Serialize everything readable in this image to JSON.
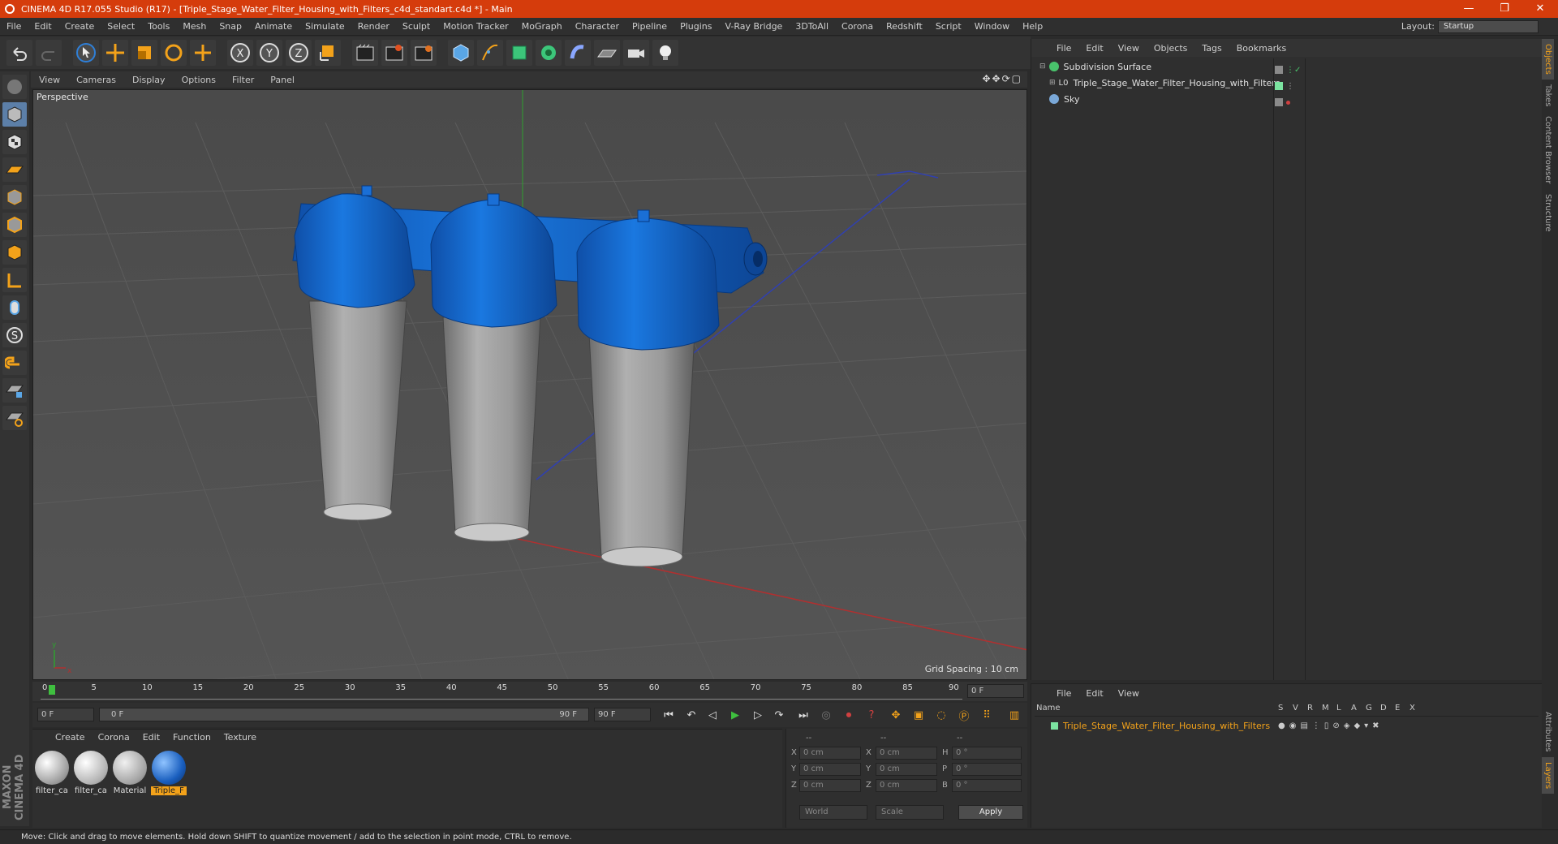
{
  "window": {
    "title": "CINEMA 4D R17.055 Studio (R17) - [Triple_Stage_Water_Filter_Housing_with_Filters_c4d_standart.c4d *] - Main",
    "controls": [
      "—",
      "❐",
      "✕"
    ]
  },
  "menubar": {
    "items": [
      "File",
      "Edit",
      "Create",
      "Select",
      "Tools",
      "Mesh",
      "Snap",
      "Animate",
      "Simulate",
      "Render",
      "Sculpt",
      "Motion Tracker",
      "MoGraph",
      "Character",
      "Pipeline",
      "Plugins",
      "V-Ray Bridge",
      "3DToAll",
      "Corona",
      "Redshift",
      "Script",
      "Window",
      "Help"
    ],
    "layout_label": "Layout:",
    "layout_value": "Startup"
  },
  "toolbar": {
    "icons": [
      "undo-icon",
      "redo-icon",
      "select-icon",
      "move-icon",
      "scale-icon",
      "rotate-icon",
      "recent-tool-icon",
      "x-axis-icon",
      "y-axis-icon",
      "z-axis-icon",
      "coordinate-system-icon",
      "render-view-icon",
      "render-picture-viewer-icon",
      "edit-render-settings-icon",
      "cube-icon",
      "pen-icon",
      "subdivision-icon",
      "array-icon",
      "deformer-icon",
      "floor-icon",
      "camera-icon",
      "light-icon"
    ]
  },
  "viewport": {
    "menu": [
      "View",
      "Cameras",
      "Display",
      "Options",
      "Filter",
      "Panel"
    ],
    "label": "Perspective",
    "grid_spacing": "Grid Spacing : 10 cm",
    "accent_blue": "#1a6fd6",
    "body_gray": "#9a9a9a"
  },
  "object_manager": {
    "menu": [
      "File",
      "Edit",
      "View",
      "Objects",
      "Tags",
      "Bookmarks"
    ],
    "objects": [
      {
        "name": "Subdivision Surface",
        "color": "#49c36c"
      },
      {
        "name": "Triple_Stage_Water_Filter_Housing_with_Filters",
        "color": "#ffffff"
      },
      {
        "name": "Sky",
        "color": "#7aa8d8"
      }
    ]
  },
  "side_tabs": [
    "Objects",
    "Takes",
    "Content Browser",
    "Structure"
  ],
  "side_tabs_bottom": [
    "Attributes",
    "Layers"
  ],
  "timeline": {
    "ticks": [
      "0",
      "5",
      "10",
      "15",
      "20",
      "25",
      "30",
      "35",
      "40",
      "45",
      "50",
      "55",
      "60",
      "65",
      "70",
      "75",
      "80",
      "85",
      "90"
    ],
    "current_frame": "0 F"
  },
  "transport": {
    "start": "0 F",
    "range_start": "0 F",
    "range_end": "90 F",
    "end": "90 F"
  },
  "material_manager": {
    "menu": [
      "Create",
      "Corona",
      "Edit",
      "Function",
      "Texture"
    ],
    "materials": [
      {
        "label": "filter_ca",
        "color": "#d8d8d8"
      },
      {
        "label": "filter_ca",
        "color": "#e4e4e4"
      },
      {
        "label": "Material",
        "color": "#cfcfcf"
      },
      {
        "label": "Triple_F",
        "color": "#1a5fbf"
      }
    ]
  },
  "coordinates": {
    "header": [
      "--",
      "--",
      "--"
    ],
    "rows": [
      {
        "a": "X",
        "a_val": "0 cm",
        "b": "X",
        "b_val": "0 cm",
        "c": "H",
        "c_val": "0 °"
      },
      {
        "a": "Y",
        "a_val": "0 cm",
        "b": "Y",
        "b_val": "0 cm",
        "c": "P",
        "c_val": "0 °"
      },
      {
        "a": "Z",
        "a_val": "0 cm",
        "b": "Z",
        "b_val": "0 cm",
        "c": "B",
        "c_val": "0 °"
      }
    ],
    "mode1": "World",
    "mode2": "Scale",
    "apply": "Apply"
  },
  "layer_manager": {
    "menu": [
      "File",
      "Edit",
      "View"
    ],
    "columns": [
      "Name",
      "S",
      "V",
      "R",
      "M",
      "L",
      "A",
      "G",
      "D",
      "E",
      "X"
    ],
    "row": "Triple_Stage_Water_Filter_Housing_with_Filters"
  },
  "status": "Move: Click and drag to move elements. Hold down SHIFT to quantize movement / add to the selection in point mode, CTRL to remove.",
  "brand": "MAXON CINEMA 4D"
}
